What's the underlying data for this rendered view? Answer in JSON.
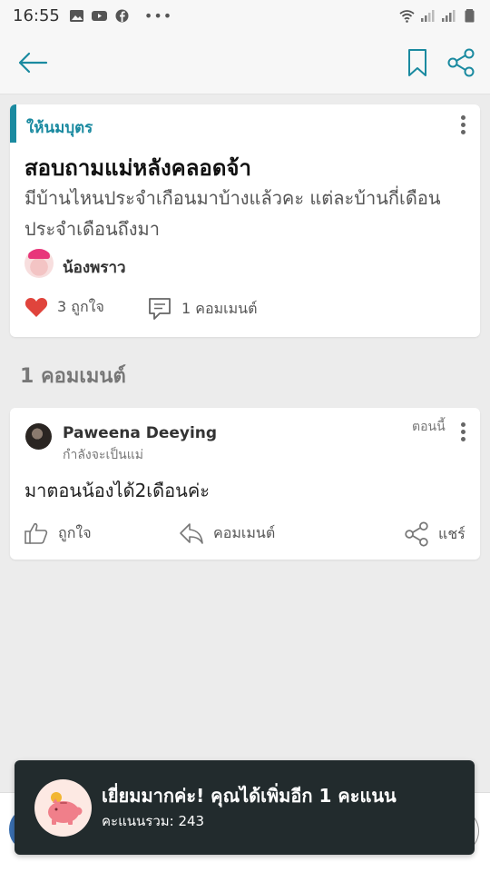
{
  "status_bar": {
    "time": "16:55",
    "left_icons": [
      "gallery-icon",
      "youtube-icon",
      "facebook-icon",
      "more-dots-icon"
    ],
    "right_icons": [
      "wifi-icon",
      "signal-icon",
      "signal-icon",
      "battery-icon"
    ]
  },
  "header": {
    "icons": [
      "back-arrow-icon",
      "bookmark-icon",
      "share-icon"
    ]
  },
  "post": {
    "category": "ให้นมบุตร",
    "title": "สอบถามแม่หลังคลอดจ้า",
    "body": "มีบ้านไหนประจำเกือนมาบ้างแล้วคะ แต่ละบ้านกี่เดือน ประจำเดือนถึงมา",
    "author": "น้องพราว",
    "likes_label": "3 ถูกใจ",
    "comments_label": "1 คอมเมนต์",
    "like_color": "#e0443c"
  },
  "comments_section": {
    "heading": "1 คอมเมนต์"
  },
  "comment": {
    "author": "Paweena Deeying",
    "subtitle": "กำลังจะเป็นแม่",
    "time": "ตอนนี้",
    "text": "มาตอนน้องได้2เดือนค่ะ",
    "like_label": "ถูกใจ",
    "reply_label": "คอมเมนต์",
    "share_label": "แชร์"
  },
  "toast": {
    "title": "เยี่ยมมากค่ะ! คุณได้เพิ่มอีก 1 คะแนน",
    "subtitle": "คะแนนรวม: 243",
    "icon": "piggy-bank-icon"
  },
  "colors": {
    "accent": "#1a8aa0",
    "toast_bg": "#222b2d",
    "background": "#ececec"
  }
}
